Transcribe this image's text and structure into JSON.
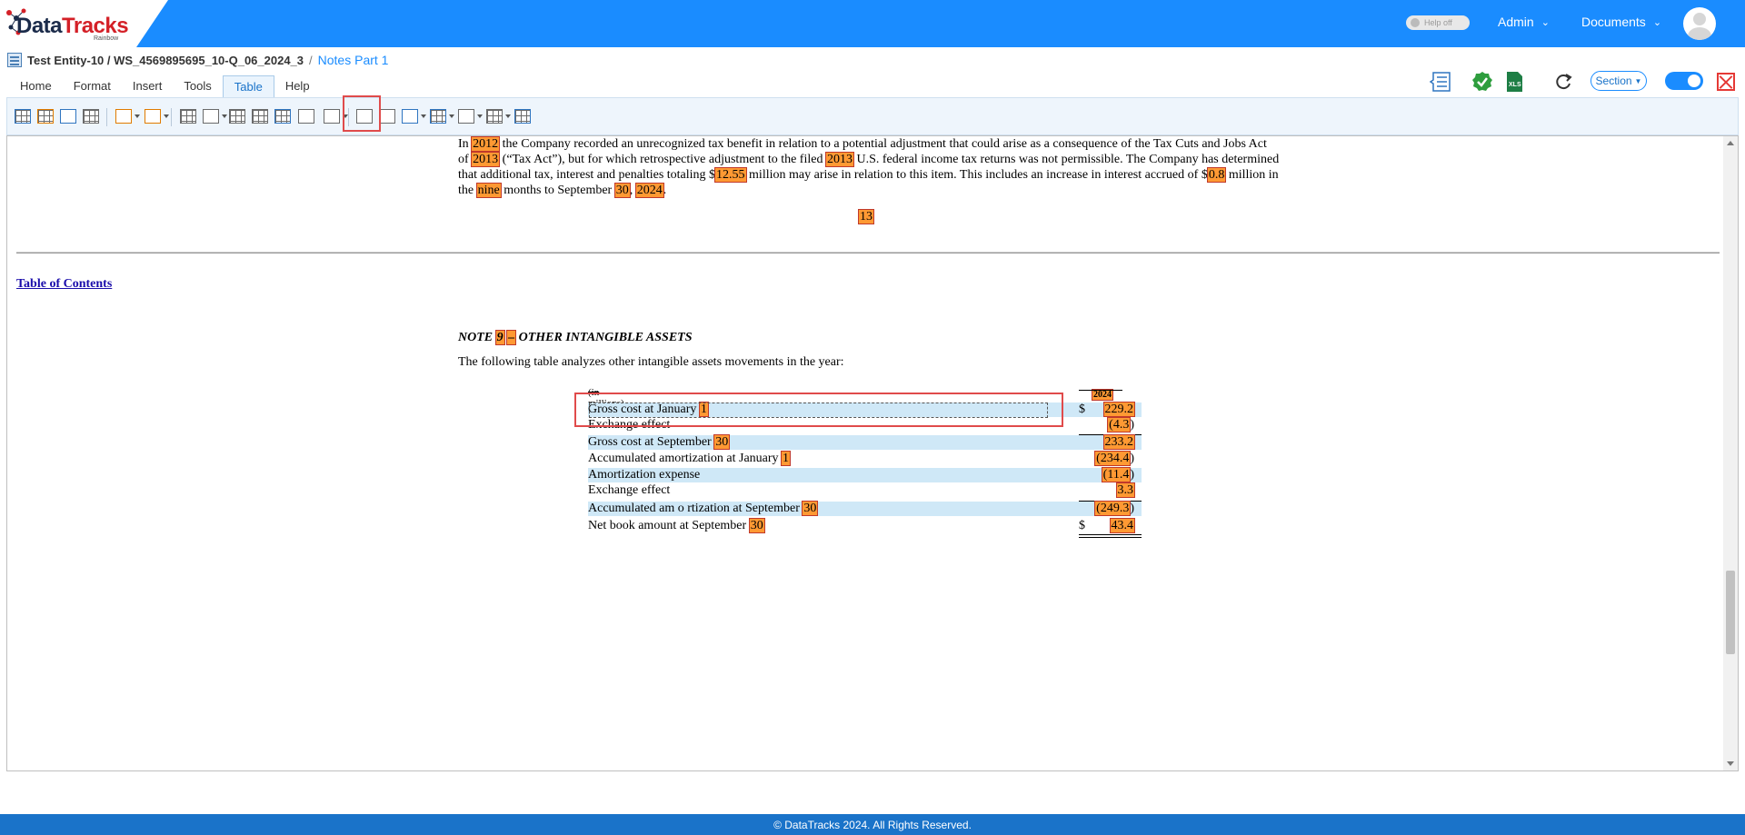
{
  "header": {
    "logo_text_a": "Data",
    "logo_text_b": "Tracks",
    "logo_sub": "Rainbow",
    "help_label": "Help off",
    "admin_label": "Admin",
    "documents_label": "Documents",
    "brand_color": "#1a8cff"
  },
  "breadcrumb": {
    "entity": "Test Entity-10 / WS_4569895695_10-Q_06_2024_3",
    "separator": "/",
    "current": "Notes Part 1"
  },
  "tabs": [
    {
      "label": "Home"
    },
    {
      "label": "Format"
    },
    {
      "label": "Insert"
    },
    {
      "label": "Tools"
    },
    {
      "label": "Table",
      "active": true
    },
    {
      "label": "Help"
    }
  ],
  "toolbar_right": {
    "section_label": "Section"
  },
  "document": {
    "para": {
      "t1": "In ",
      "m1": "2012",
      "t2": " the Company recorded an unrecognized tax benefit in relation to a potential adjustment that could arise as a consequence of the Tax Cuts and Jobs Act of ",
      "m2": "2013",
      "t3": " (“Tax Act”), but for which retrospective adjustment to the filed ",
      "m3": "2013",
      "t4": " U.S. federal income tax returns was not permissible. The Company has determined that additional tax, interest and penalties totaling $",
      "m4": "12.55",
      "t5": " million may arise in relation to this item. This includes an increase in interest accrued of $",
      "m5": "0.8",
      "t6": " million in the ",
      "m6": "nine",
      "t7": " months to September ",
      "m7": "30",
      "t8": ", ",
      "m8": "2024",
      "t9": "."
    },
    "page_number": "13",
    "toc_link": "Table of Contents",
    "note": {
      "prefix": "NOTE ",
      "num": "9",
      "dash": "–",
      "title": " OTHER INTANGIBLE ASSETS",
      "intro": "The following table analyzes other intangible assets movements in the year:"
    },
    "table": {
      "units": "(in millions)",
      "year": "2024",
      "rows": [
        {
          "label": "Gross cost at January ",
          "mark": "1",
          "dollar": "$",
          "value": "229.2",
          "suffix": ""
        },
        {
          "label": "Exchange effect",
          "mark": "",
          "dollar": "",
          "value": "(4.3",
          "suffix": ")"
        },
        {
          "label": "Gross cost at September ",
          "mark": "30",
          "dollar": "",
          "value": "233.2",
          "suffix": ""
        },
        {
          "label": "Accumulated amortization at January ",
          "mark": "1",
          "dollar": "",
          "value": "(234.4",
          "suffix": ")"
        },
        {
          "label": "Amortization expense",
          "mark": "",
          "dollar": "",
          "value": "(11.4",
          "suffix": ")"
        },
        {
          "label": "Exchange effect",
          "mark": "",
          "dollar": "",
          "value": "3.3",
          "suffix": ""
        },
        {
          "label": "Accumulated am o rtization at September ",
          "mark": "30",
          "dollar": "",
          "value": "(249.3",
          "suffix": ")"
        },
        {
          "label": "Net book amount at September ",
          "mark": "30",
          "dollar": "$",
          "value": "43.4",
          "suffix": ""
        }
      ]
    }
  },
  "footer": {
    "copyright": "© DataTracks 2024. All Rights Reserved."
  }
}
